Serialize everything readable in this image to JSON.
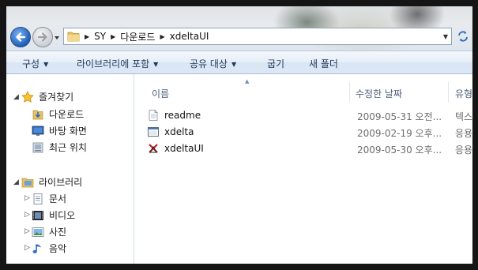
{
  "address": {
    "crumbs": [
      "SY",
      "다운로드",
      "xdeltaUI"
    ]
  },
  "toolbar": {
    "organize": "구성",
    "include_library": "라이브러리에 포함",
    "share": "공유 대상",
    "burn": "굽기",
    "new_folder": "새 폴더"
  },
  "sidebar": {
    "favorites": "즐겨찾기",
    "favorites_items": [
      "다운로드",
      "바탕 화면",
      "최근 위치"
    ],
    "libraries": "라이브러리",
    "library_items": [
      "문서",
      "비디오",
      "사진",
      "음악"
    ]
  },
  "columns": {
    "name": "이름",
    "modified": "수정한 날짜",
    "type": "유형"
  },
  "files": [
    {
      "name": "readme",
      "modified": "2009-05-31 오전...",
      "type": "텍스..."
    },
    {
      "name": "xdelta",
      "modified": "2009-02-19 오후...",
      "type": "응용..."
    },
    {
      "name": "xdeltaUI",
      "modified": "2009-05-30 오후...",
      "type": "응용..."
    }
  ],
  "icons": {
    "back": "back-arrow-icon",
    "forward": "forward-arrow-icon",
    "refresh": "refresh-icon",
    "folder": "folder-icon",
    "star": "star-icon"
  },
  "colors": {
    "accent": "#1e395b",
    "command_bar": "#dce7f5"
  }
}
